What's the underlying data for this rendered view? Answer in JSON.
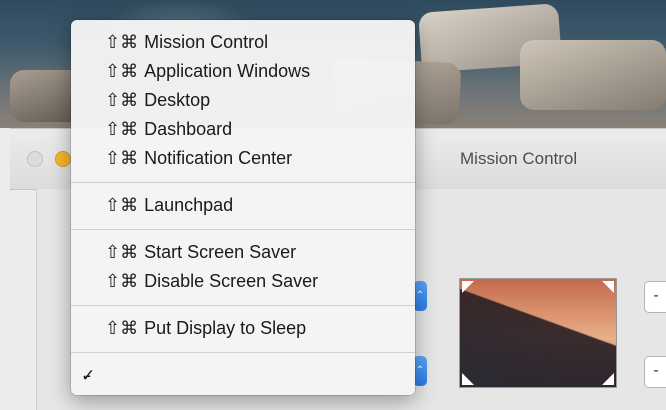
{
  "window": {
    "title": "Mission Control"
  },
  "menu": {
    "modifier": "⇧⌘",
    "groups": [
      [
        "Mission Control",
        "Application Windows",
        "Desktop",
        "Dashboard",
        "Notification Center"
      ],
      [
        "Launchpad"
      ],
      [
        "Start Screen Saver",
        "Disable Screen Saver"
      ],
      [
        "Put Display to Sleep"
      ]
    ],
    "checked_item": "-",
    "check_glyph": "✓"
  },
  "controls": {
    "stepper_glyph": "⌃",
    "side_button_glyph": "-"
  }
}
